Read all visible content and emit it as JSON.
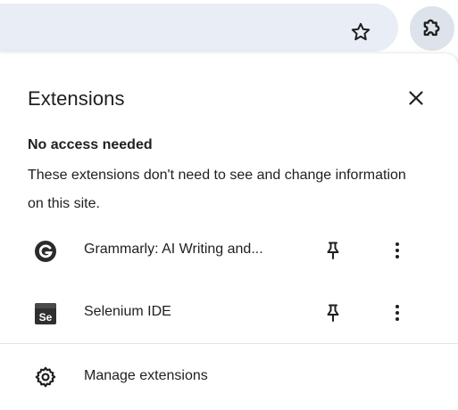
{
  "toolbar": {
    "star_icon": "star-outline-icon",
    "extensions_icon": "puzzle-piece-icon"
  },
  "popup": {
    "title": "Extensions",
    "close_icon": "close-icon",
    "section": {
      "heading": "No access needed",
      "description": "These extensions don't need to see and change information on this site."
    },
    "extensions": [
      {
        "name": "Grammarly: AI Writing and...",
        "icon": "grammarly-icon",
        "pin_icon": "pin-icon",
        "more_icon": "more-vert-icon"
      },
      {
        "name": "Selenium IDE",
        "icon": "selenium-ide-icon",
        "icon_text": "Se",
        "pin_icon": "pin-icon",
        "more_icon": "more-vert-icon"
      }
    ],
    "manage": {
      "label": "Manage extensions",
      "icon": "gear-icon"
    }
  },
  "colors": {
    "omnibox_bg": "#e9eef6",
    "extension_button_bg": "#dde3ea",
    "text": "#1f1f1f",
    "divider": "#e3e3e3"
  }
}
